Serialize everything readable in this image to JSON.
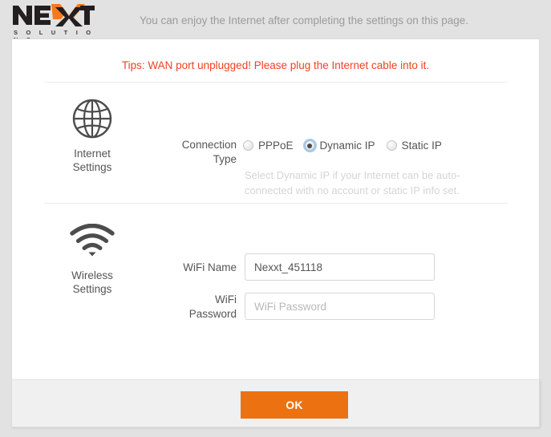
{
  "brand": {
    "logo_text": "NEXXT",
    "logo_subtitle": "S O L U T I O N S",
    "orange": "#f47920",
    "dark": "#231f20"
  },
  "header": {
    "note": "You can enjoy the Internet after completing the settings on this page."
  },
  "card": {
    "tips": "Tips: WAN port unplugged! Please plug the Internet cable into it.",
    "tips_color": "#f04124"
  },
  "internet_section": {
    "icon": "globe-icon",
    "title_line1": "Internet",
    "title_line2": "Settings",
    "field_label_line1": "Connection",
    "field_label_line2": "Type",
    "options": [
      {
        "label": "PPPoE",
        "selected": false
      },
      {
        "label": "Dynamic IP",
        "selected": true
      },
      {
        "label": "Static IP",
        "selected": false
      }
    ],
    "hint": "Select Dynamic IP if your Internet can be auto-connected with no account or static IP info set."
  },
  "wireless_section": {
    "icon": "wifi-icon",
    "title_line1": "Wireless",
    "title_line2": "Settings",
    "wifi_name_label": "WiFi Name",
    "wifi_name_value": "Nexxt_451118",
    "wifi_password_label_line1": "WiFi",
    "wifi_password_label_line2": "Password",
    "wifi_password_value": "",
    "wifi_password_placeholder": "WiFi Password"
  },
  "footer": {
    "ok_label": "OK",
    "ok_color": "#ec7211"
  }
}
